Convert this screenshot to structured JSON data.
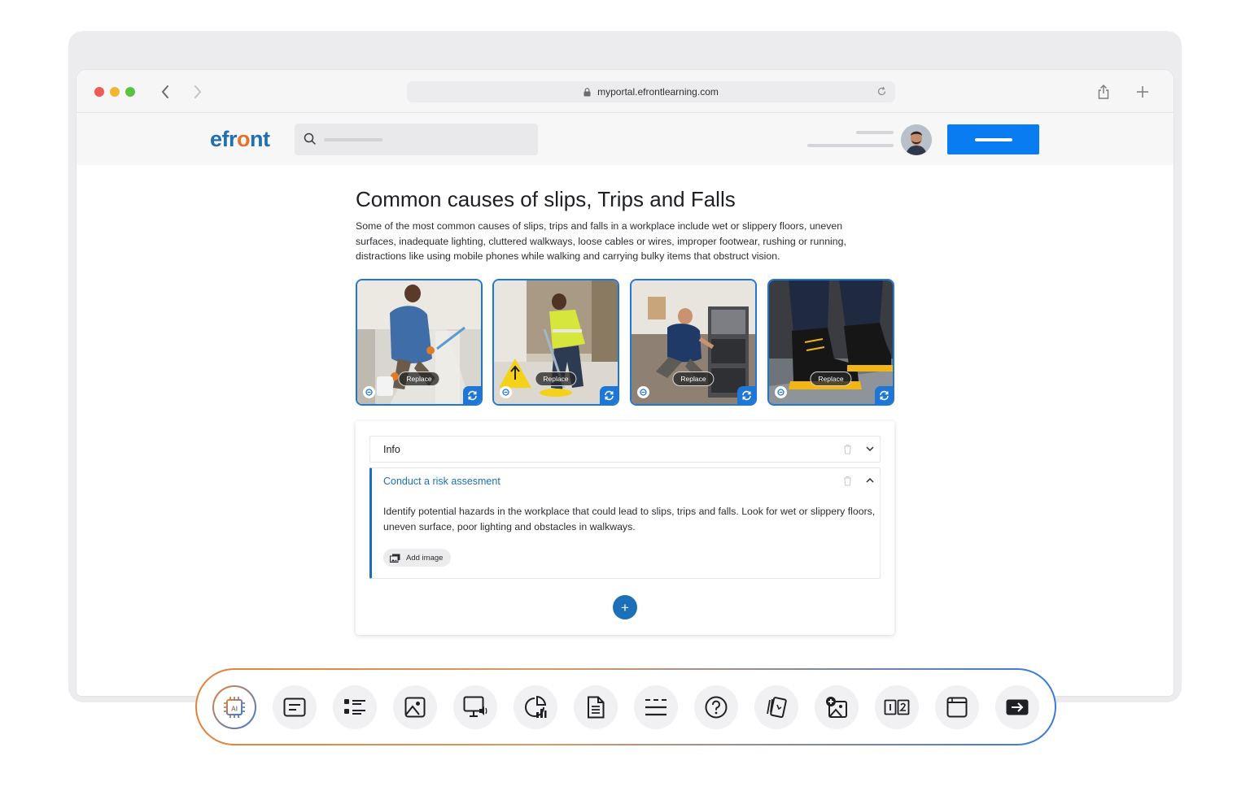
{
  "browser": {
    "url": "myportal.efrontlearning.com"
  },
  "app": {
    "logo_prefix": "efr",
    "logo_accent": "o",
    "logo_suffix": "nt",
    "brand_color": "#1f6fb2",
    "accent_color": "#e4712e",
    "primary_button_color": "#0a7cf2"
  },
  "content": {
    "title": "Common causes of slips, Trips and Falls",
    "description": "Some of the most common causes of slips, trips and falls in a workplace include wet or slippery floors, uneven surfaces, inadequate lighting, cluttered walkways, loose cables or wires, improper footwear, rushing or running, distractions like using mobile phones while walking and carrying bulky items that obstruct vision.",
    "images": [
      {
        "replace_label": "Replace"
      },
      {
        "replace_label": "Replace"
      },
      {
        "replace_label": "Replace"
      },
      {
        "replace_label": "Replace"
      }
    ]
  },
  "accordion": {
    "items": [
      {
        "label": "Info",
        "expanded": false
      },
      {
        "label": "Conduct a risk assesment",
        "expanded": true,
        "body": "Identify potential hazards in the workplace that could lead to slips, trips and falls. Look for wet or slippery floors, uneven surface, poor lighting and obstacles in walkways.",
        "add_image_label": "Add image"
      }
    ],
    "add_button": "+"
  },
  "toolbar": {
    "tools": [
      {
        "icon": "ai-chip-icon"
      },
      {
        "icon": "text-block-icon"
      },
      {
        "icon": "list-icon"
      },
      {
        "icon": "image-icon"
      },
      {
        "icon": "video-presentation-icon"
      },
      {
        "icon": "chart-icon"
      },
      {
        "icon": "document-icon"
      },
      {
        "icon": "divider-lines-icon"
      },
      {
        "icon": "question-icon"
      },
      {
        "icon": "flashcards-icon"
      },
      {
        "icon": "add-image-icon"
      },
      {
        "icon": "comparison-icon"
      },
      {
        "icon": "window-icon"
      },
      {
        "icon": "next-arrow-icon"
      }
    ]
  }
}
